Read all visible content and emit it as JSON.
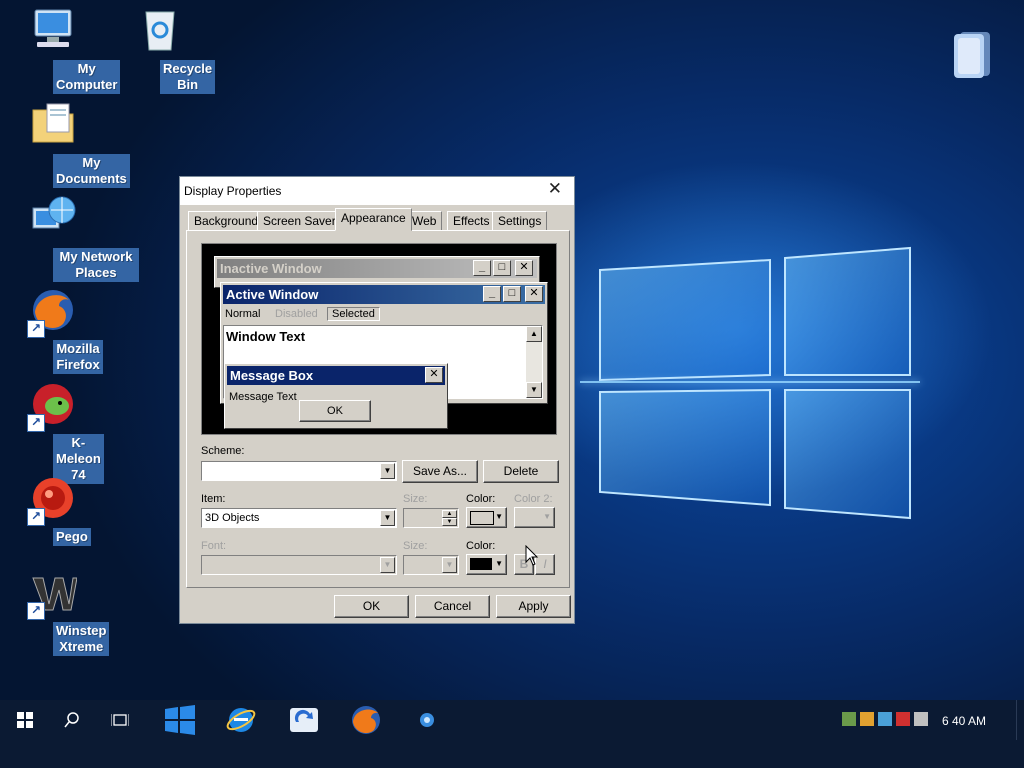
{
  "desktop": {
    "icons": [
      {
        "label": "My Computer",
        "icon": "computer-icon"
      },
      {
        "label": "Recycle Bin",
        "icon": "recycle-bin-icon"
      },
      {
        "label": "My Documents",
        "icon": "documents-folder-icon"
      },
      {
        "label": "My Network Places",
        "icon": "network-places-icon"
      },
      {
        "label": "Mozilla Firefox",
        "icon": "firefox-icon"
      },
      {
        "label": "K-Meleon 74",
        "icon": "k-meleon-icon"
      },
      {
        "label": "Pego",
        "icon": "pego-icon"
      },
      {
        "label": "Winstep Xtreme",
        "icon": "winstep-icon"
      }
    ],
    "wallpaper_accent": "#0b4aa6"
  },
  "dialog": {
    "title": "Display Properties",
    "tabs": [
      "Background",
      "Screen Saver",
      "Appearance",
      "Web",
      "Effects",
      "Settings"
    ],
    "active_tab": "Appearance",
    "preview": {
      "inactive_title": "Inactive Window",
      "active_title": "Active Window",
      "menu": [
        "Normal",
        "Disabled",
        "Selected"
      ],
      "window_text": "Window Text",
      "msgbox_title": "Message Box",
      "msgbox_text": "Message Text",
      "ok": "OK",
      "active_title_color": "#0a246a",
      "inactive_title_color": "#808080"
    },
    "scheme": {
      "label": "Scheme:",
      "value": "",
      "save_as": "Save As...",
      "delete": "Delete"
    },
    "item": {
      "label": "Item:",
      "value": "3D Objects",
      "size_label": "Size:",
      "color_label": "Color:",
      "color2_label": "Color 2:"
    },
    "font": {
      "label": "Font:",
      "size_label": "Size:",
      "color_label": "Color:",
      "bold": "B",
      "italic": "I"
    },
    "buttons": {
      "ok": "OK",
      "cancel": "Cancel",
      "apply": "Apply"
    }
  },
  "taskbar": {
    "clock": "6 40 AM",
    "pinned": [
      "windows-tile-icon",
      "internet-explorer-icon",
      "sync-icon",
      "firefox-icon",
      "k-meleon-icon"
    ]
  }
}
